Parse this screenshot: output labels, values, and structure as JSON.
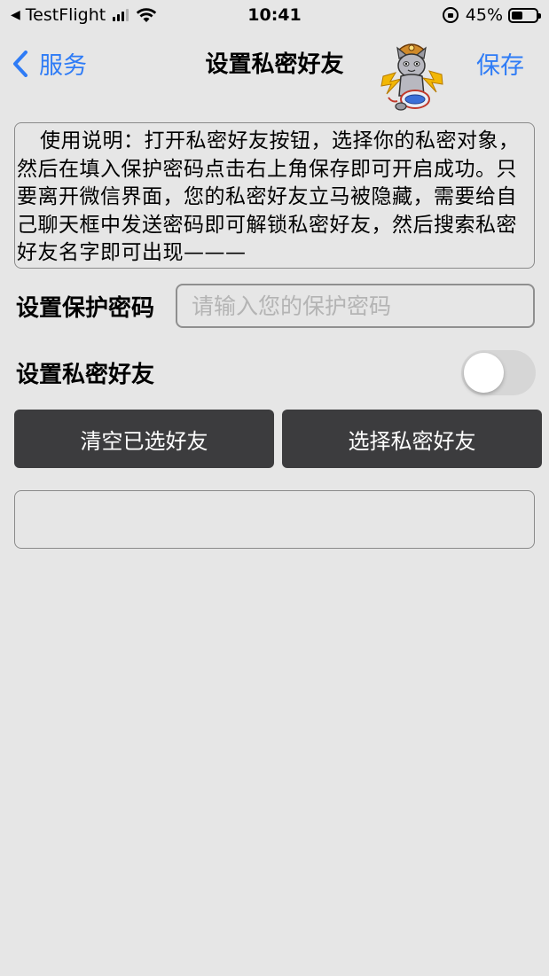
{
  "status_bar": {
    "back_app": "TestFlight",
    "time": "10:41",
    "battery_text": "45%",
    "battery_level": 0.45
  },
  "nav": {
    "back_label": "服务",
    "title": "设置私密好友",
    "save_label": "保存"
  },
  "instructions": {
    "text": "使用说明：打开私密好友按钮，选择你的私密对象，然后在填入保护密码点击右上角保存即可开启成功。只要离开微信界面，您的私密好友立马被隐藏，需要给自己聊天框中发送密码即可解锁私密好友，然后搜索私密好友名字即可出现———"
  },
  "password": {
    "label": "设置保护密码",
    "value": "",
    "placeholder": "请输入您的保护密码"
  },
  "private_friend": {
    "label": "设置私密好友",
    "enabled": false
  },
  "buttons": {
    "clear_label": "清空已选好友",
    "select_label": "选择私密好友"
  },
  "colors": {
    "accent": "#2f7cf6",
    "button_bg": "#3c3c3e",
    "page_bg": "#e6e6e6"
  }
}
